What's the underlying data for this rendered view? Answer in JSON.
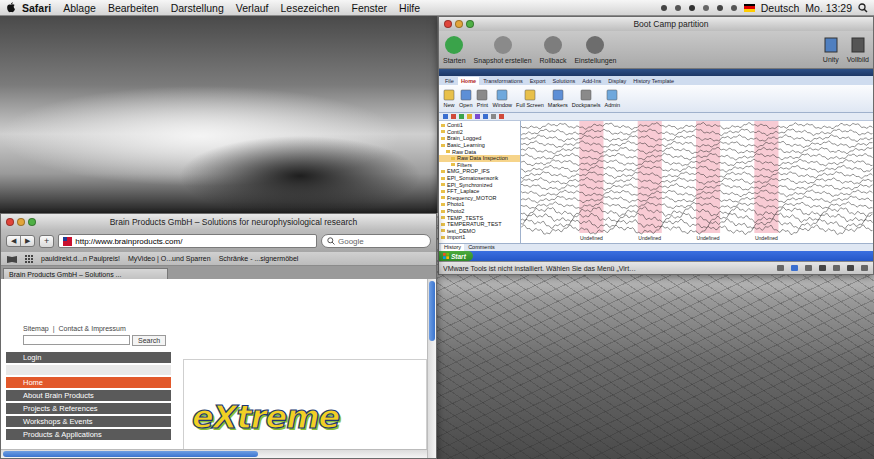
{
  "menubar": {
    "items": [
      {
        "label": "Safari",
        "bold": true
      },
      {
        "label": "Ablage",
        "bold": false
      },
      {
        "label": "Bearbeiten",
        "bold": false
      },
      {
        "label": "Darstellung",
        "bold": false
      },
      {
        "label": "Verlauf",
        "bold": false
      },
      {
        "label": "Lesezeichen",
        "bold": false
      },
      {
        "label": "Fenster",
        "bold": false
      },
      {
        "label": "Hilfe",
        "bold": false
      }
    ],
    "language": "Deutsch",
    "clock": "Mo. 13:29"
  },
  "vmware": {
    "title": "Boot Camp partition",
    "toolbar": [
      {
        "label": "Starten"
      },
      {
        "label": "Snapshot erstellen"
      },
      {
        "label": "Rollback"
      },
      {
        "label": "Einstellungen"
      }
    ],
    "view_buttons": [
      {
        "label": "Unity"
      },
      {
        "label": "Vollbild"
      }
    ],
    "status": "VMware Tools ist nicht installiert. Wählen Sie das Menü „Virt…"
  },
  "guest": {
    "taskbar": {
      "start": "Start"
    },
    "analyzer": {
      "ribbon_tabs": [
        {
          "label": "File",
          "selected": false
        },
        {
          "label": "Home",
          "selected": true
        },
        {
          "label": "Transformations",
          "selected": false
        },
        {
          "label": "Export",
          "selected": false
        },
        {
          "label": "Solutions",
          "selected": false
        },
        {
          "label": "Add-Ins",
          "selected": false
        },
        {
          "label": "Display",
          "selected": false
        },
        {
          "label": "History Template",
          "selected": false
        }
      ],
      "ribbon_buttons": [
        "New",
        "Open",
        "Print",
        "Window",
        "Full Screen",
        "Markers",
        "Dockpanels",
        "Admin"
      ],
      "tree": [
        {
          "label": "Conti1",
          "depth": 0,
          "selected": false
        },
        {
          "label": "Conti2",
          "depth": 0,
          "selected": false
        },
        {
          "label": "Brain_Logged",
          "depth": 0,
          "selected": false
        },
        {
          "label": "Basic_Learning",
          "depth": 0,
          "selected": false
        },
        {
          "label": "Raw Data",
          "depth": 1,
          "selected": false
        },
        {
          "label": "Raw Data Inspection",
          "depth": 2,
          "selected": true
        },
        {
          "label": "Filters",
          "depth": 2,
          "selected": false
        },
        {
          "label": "EMG_PROP_IFS",
          "depth": 0,
          "selected": false
        },
        {
          "label": "EPI_Somatosensorik",
          "depth": 0,
          "selected": false
        },
        {
          "label": "EPI_Synchronized",
          "depth": 0,
          "selected": false
        },
        {
          "label": "FFT_Laplace",
          "depth": 0,
          "selected": false
        },
        {
          "label": "Frequency_MOTOR",
          "depth": 0,
          "selected": false
        },
        {
          "label": "Photo1",
          "depth": 0,
          "selected": false
        },
        {
          "label": "Photo2",
          "depth": 0,
          "selected": false
        },
        {
          "label": "TEMP_TESTS",
          "depth": 0,
          "selected": false
        },
        {
          "label": "TEMPERATUR_TEST",
          "depth": 0,
          "selected": false
        },
        {
          "label": "test_DEMO",
          "depth": 0,
          "selected": false
        },
        {
          "label": "import1",
          "depth": 0,
          "selected": false
        }
      ],
      "markers": [
        {
          "label": "Undefined"
        },
        {
          "label": "Undefined"
        },
        {
          "label": "Undefined"
        },
        {
          "label": "Undefined"
        }
      ],
      "panel_tabs": [
        {
          "label": "History",
          "selected": true
        },
        {
          "label": "Comments",
          "selected": false
        }
      ]
    }
  },
  "safari": {
    "title": "Brain Products GmbH – Solutions for neurophysiological research",
    "nav_buttons": [
      "◀",
      "▶"
    ],
    "add_button": "+",
    "url": "http://www.brainproducts.com/",
    "search_placeholder": "Google",
    "bookmarks": [
      "pauldirekt.d...n Paulpreis!",
      "MyVideo | O...und Sparren",
      "Schränke - ...signermöbel"
    ],
    "tab": "Brain Products GmbH – Solutions ...",
    "page": {
      "top_links": [
        "Sitemap",
        "|",
        "Contact & Impressum"
      ],
      "search_button": "Search",
      "login": "Login",
      "nav": [
        {
          "label": "Home",
          "selected": true
        },
        {
          "label": "About Brain Products",
          "selected": false
        },
        {
          "label": "Projects & References",
          "selected": false
        },
        {
          "label": "Workshops & Events",
          "selected": false
        },
        {
          "label": "Products & Applications",
          "selected": false
        }
      ],
      "logo": "eXtreme"
    }
  }
}
